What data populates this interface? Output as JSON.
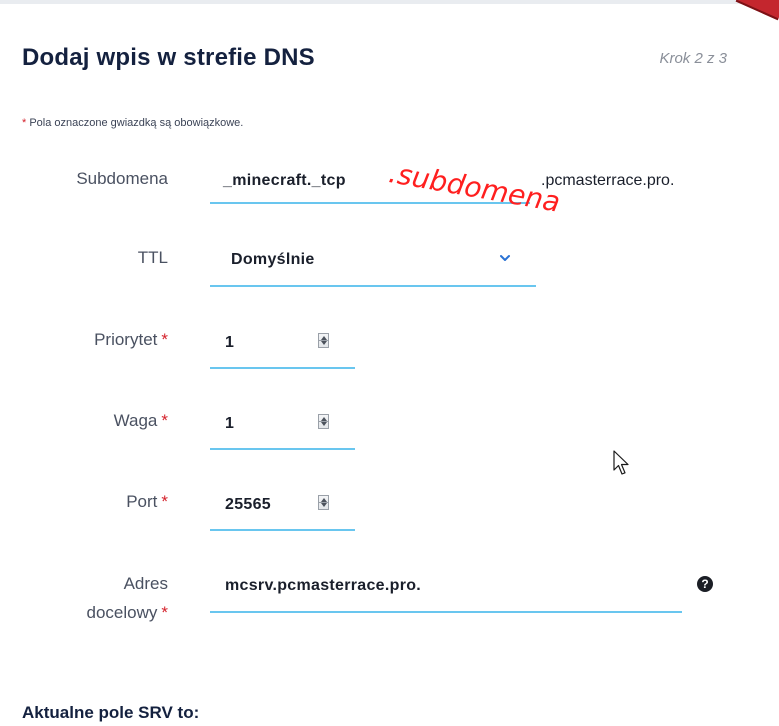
{
  "header": {
    "title": "Dodaj wpis w strefie DNS",
    "step": "Krok 2 z 3"
  },
  "required_note": {
    "star": "*",
    "text": "Pola oznaczone gwiazdką są obowiązkowe."
  },
  "form": {
    "subdomain": {
      "label": "Subdomena",
      "value": "_minecraft._tcp",
      "suffix": ".pcmasterrace.pro."
    },
    "ttl": {
      "label": "TTL",
      "value": "Domyślnie"
    },
    "priority": {
      "label": "Priorytet",
      "star": "*",
      "value": "1"
    },
    "weight": {
      "label": "Waga",
      "star": "*",
      "value": "1"
    },
    "port": {
      "label": "Port",
      "star": "*",
      "value": "25565"
    },
    "target": {
      "label_line1": "Adres",
      "label_line2": "docelowy",
      "star": "*",
      "value": "mcsrv.pcmasterrace.pro.",
      "help_glyph": "?"
    }
  },
  "summary": {
    "title": "Aktualne pole SRV to:"
  },
  "annotation": {
    "handwritten_text": ".subdomena",
    "color": "#ff1f1f"
  },
  "colors": {
    "accent_underline": "#69c6ef",
    "title_text": "#14213f",
    "required_star": "#d4202a",
    "chevron": "#2a72d4",
    "corner_accent": "#c4262e"
  },
  "icons": {
    "ttl_dropdown": "chevron-down-icon",
    "number_spinner": "spinner-arrows-icon",
    "help": "question-circle-icon",
    "cursor": "mouse-pointer-icon"
  }
}
